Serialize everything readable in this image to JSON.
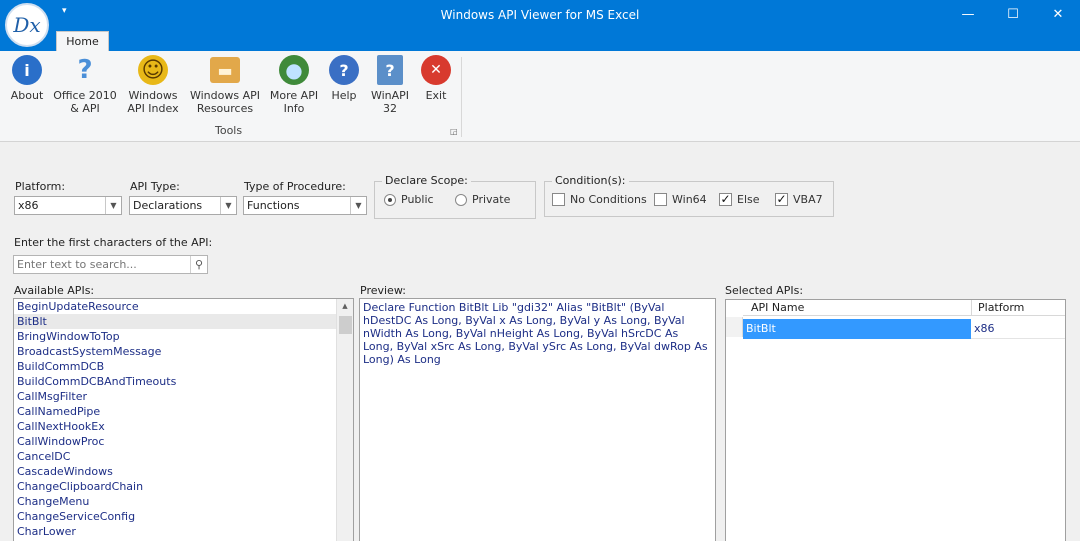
{
  "window": {
    "title": "Windows API Viewer for MS Excel",
    "minimize_glyph": "—",
    "maximize_glyph": "☐",
    "close_glyph": "✕",
    "logo_text": "Dx",
    "qat_glyph": "▾"
  },
  "ribbon": {
    "tab": "Home",
    "buttons": [
      {
        "label1": "About",
        "label2": "",
        "icon": "info-icon",
        "glyph": "i",
        "color": "#2a6fc9"
      },
      {
        "label1": "Office 2010",
        "label2": "& API",
        "icon": "help-question-icon",
        "glyph": "?",
        "color": "#4a8fd8"
      },
      {
        "label1": "Windows",
        "label2": "API Index",
        "icon": "smiley-index-icon",
        "glyph": "☺",
        "color": "#e8b818"
      },
      {
        "label1": "Windows API",
        "label2": "Resources",
        "icon": "folder-icon",
        "glyph": "▬",
        "color": "#e2a84a"
      },
      {
        "label1": "More API",
        "label2": "Info",
        "icon": "globe-icon",
        "glyph": "●",
        "color": "#3f8a3a"
      },
      {
        "label1": "Help",
        "label2": "",
        "icon": "help-icon",
        "glyph": "?",
        "color": "#3a6fc4"
      },
      {
        "label1": "WinAPI",
        "label2": "32",
        "icon": "winapi-doc-icon",
        "glyph": "?",
        "color": "#5b8fc9"
      },
      {
        "label1": "Exit",
        "label2": "",
        "icon": "exit-icon",
        "glyph": "✕",
        "color": "#d83a2e"
      }
    ],
    "group_label": "Tools",
    "launcher_glyph": "◲"
  },
  "form": {
    "platform": {
      "label": "Platform:",
      "value": "x86"
    },
    "api_type": {
      "label": "API Type:",
      "value": "Declarations"
    },
    "procedure": {
      "label": "Type of Procedure:",
      "value": "Functions"
    },
    "combo_arrow": "▼",
    "declare_scope": {
      "label": "Declare Scope:",
      "public": "Public",
      "private": "Private",
      "selected": "Public"
    },
    "conditions": {
      "label": "Condition(s):",
      "items": [
        {
          "label": "No Conditions",
          "checked": false
        },
        {
          "label": "Win64",
          "checked": false
        },
        {
          "label": "Else",
          "checked": true
        },
        {
          "label": "VBA7",
          "checked": true
        }
      ]
    },
    "search_label": "Enter the first characters of the API:",
    "search_placeholder": "Enter text to search...",
    "search_glyph": "⚲"
  },
  "available": {
    "label": "Available APIs:",
    "selected": "BitBlt",
    "scroll_up_glyph": "▲",
    "items": [
      "BeginUpdateResource",
      "BitBlt",
      "BringWindowToTop",
      "BroadcastSystemMessage",
      "BuildCommDCB",
      "BuildCommDCBAndTimeouts",
      "CallMsgFilter",
      "CallNamedPipe",
      "CallNextHookEx",
      "CallWindowProc",
      "CancelDC",
      "CascadeWindows",
      "ChangeClipboardChain",
      "ChangeMenu",
      "ChangeServiceConfig",
      "CharLower"
    ]
  },
  "preview": {
    "label": "Preview:",
    "text": "Declare Function BitBlt Lib \"gdi32\" Alias \"BitBlt\" (ByVal hDestDC As Long, ByVal x As Long, ByVal y As Long, ByVal nWidth As Long, ByVal nHeight As Long, ByVal hSrcDC As Long, ByVal xSrc As Long, ByVal ySrc As Long, ByVal dwRop As Long) As Long"
  },
  "selected": {
    "label": "Selected APIs:",
    "columns": [
      "API Name",
      "Platform"
    ],
    "rows": [
      {
        "name": "BitBlt",
        "platform": "x86"
      }
    ]
  },
  "colors": {
    "titlebar": "#0078d7",
    "selection": "#3399ff",
    "list_text": "#1d2e86"
  }
}
